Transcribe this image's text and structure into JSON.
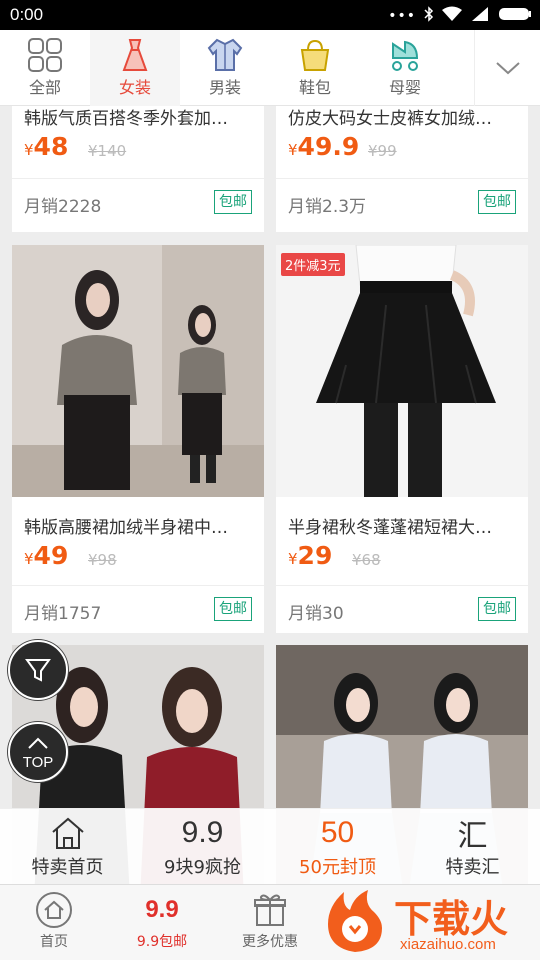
{
  "status_bar": {
    "time": "0:00"
  },
  "categories": [
    {
      "label": "全部",
      "icon": "grid-icon",
      "active": false
    },
    {
      "label": "女装",
      "icon": "dress-icon",
      "active": true
    },
    {
      "label": "男装",
      "icon": "shirt-icon",
      "active": false
    },
    {
      "label": "鞋包",
      "icon": "bag-icon",
      "active": false
    },
    {
      "label": "母婴",
      "icon": "stroller-icon",
      "active": false
    }
  ],
  "products": [
    {
      "title": "韩版气质百搭冬季外套加…",
      "price": "48",
      "original_price": "¥140",
      "sales": "月销2228",
      "tag": "包邮"
    },
    {
      "title": "仿皮大码女士皮裤女加绒…",
      "price": "49.9",
      "original_price": "¥99",
      "sales": "月销2.3万",
      "tag": "包邮"
    },
    {
      "title": "韩版高腰裙加绒半身裙中…",
      "price": "49",
      "original_price": "¥98",
      "sales": "月销1757",
      "tag": "包邮"
    },
    {
      "title": "半身裙秋冬蓬蓬裙短裙大…",
      "price": "29",
      "original_price": "¥68",
      "sales": "月销30",
      "tag": "包邮",
      "promo": "2件减3元"
    },
    {
      "title": "",
      "price": "",
      "original_price": "",
      "sales": "",
      "tag": ""
    },
    {
      "title": "",
      "price": "",
      "original_price": "",
      "sales": "",
      "tag": ""
    }
  ],
  "currency_symbol": "¥",
  "floating": {
    "top_label": "TOP"
  },
  "sale_nav": [
    {
      "label": "特卖首页",
      "icon": "home-icon",
      "active": false
    },
    {
      "label": "9块9疯抢",
      "icon_text": "9.9",
      "active": false
    },
    {
      "label": "50元封顶",
      "icon_text": "50",
      "active": true
    },
    {
      "label": "特卖汇",
      "icon_text": "汇",
      "active": false
    }
  ],
  "bottom_tabs": [
    {
      "label": "首页",
      "icon": "home-circle-icon",
      "active": false
    },
    {
      "label": "9.9包邮",
      "icon_text": "9.9",
      "active": true
    },
    {
      "label": "更多优惠",
      "icon": "gift-icon",
      "active": false
    }
  ],
  "watermark": {
    "brand": "下载火",
    "url": "xiazaihuo.com"
  },
  "colors": {
    "accent": "#f05b13",
    "tab_active": "#e64a3b",
    "free_shipping": "#1aa37a"
  }
}
